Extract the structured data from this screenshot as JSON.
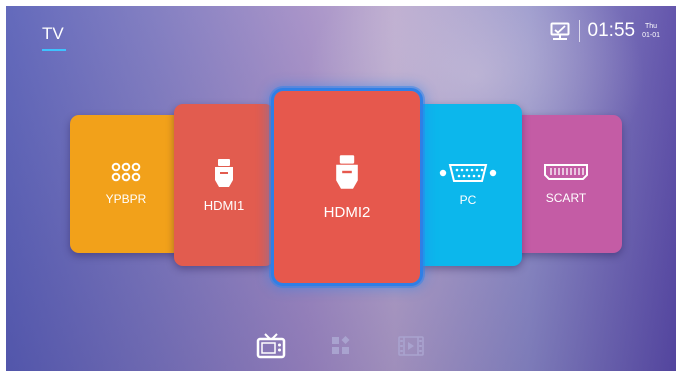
{
  "header": {
    "tab_label": "TV",
    "time": "01:55",
    "weekday": "Thu",
    "date": "01-01",
    "network_icon": "network-icon"
  },
  "sources": [
    {
      "label": "YPBPR",
      "icon": "component-connector-icon",
      "color": "#f2a11a"
    },
    {
      "label": "HDMI1",
      "icon": "hdmi-connector-icon",
      "color": "#e25c4f"
    },
    {
      "label": "HDMI2",
      "icon": "hdmi-connector-icon",
      "color": "#e6584d",
      "selected": true
    },
    {
      "label": "PC",
      "icon": "vga-connector-icon",
      "color": "#0cb7ec"
    },
    {
      "label": "SCART",
      "icon": "scart-connector-icon",
      "color": "#c45ca5"
    }
  ],
  "dock": [
    {
      "icon": "tv-icon",
      "active": true
    },
    {
      "icon": "apps-icon",
      "active": false
    },
    {
      "icon": "media-icon",
      "active": false
    }
  ],
  "colors": {
    "focus": "#2f7fe6",
    "tab_underline": "#3ec2ff"
  }
}
